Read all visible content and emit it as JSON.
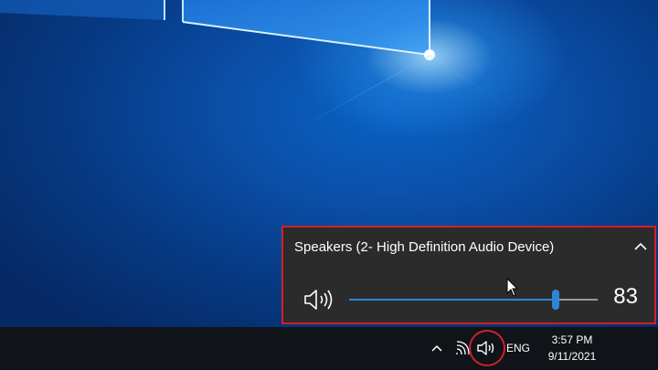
{
  "volume_flyout": {
    "device_name": "Speakers (2- High Definition Audio Device)",
    "volume_value": "83",
    "volume_level_percent": 83,
    "speaker_icon": "speaker-icon",
    "expand_icon": "chevron-up-icon"
  },
  "taskbar": {
    "language": "ENG",
    "time": "3:57 PM",
    "date": "9/11/2021",
    "tray_icons": [
      "chevron-up-icon",
      "network-icon",
      "volume-icon"
    ]
  },
  "colors": {
    "desktop_blue": "#0a4fa8",
    "flyout_background": "#2b2b2b",
    "accent": "#2e85d8",
    "highlight_red": "#d0202a",
    "taskbar_background": "#101318"
  }
}
